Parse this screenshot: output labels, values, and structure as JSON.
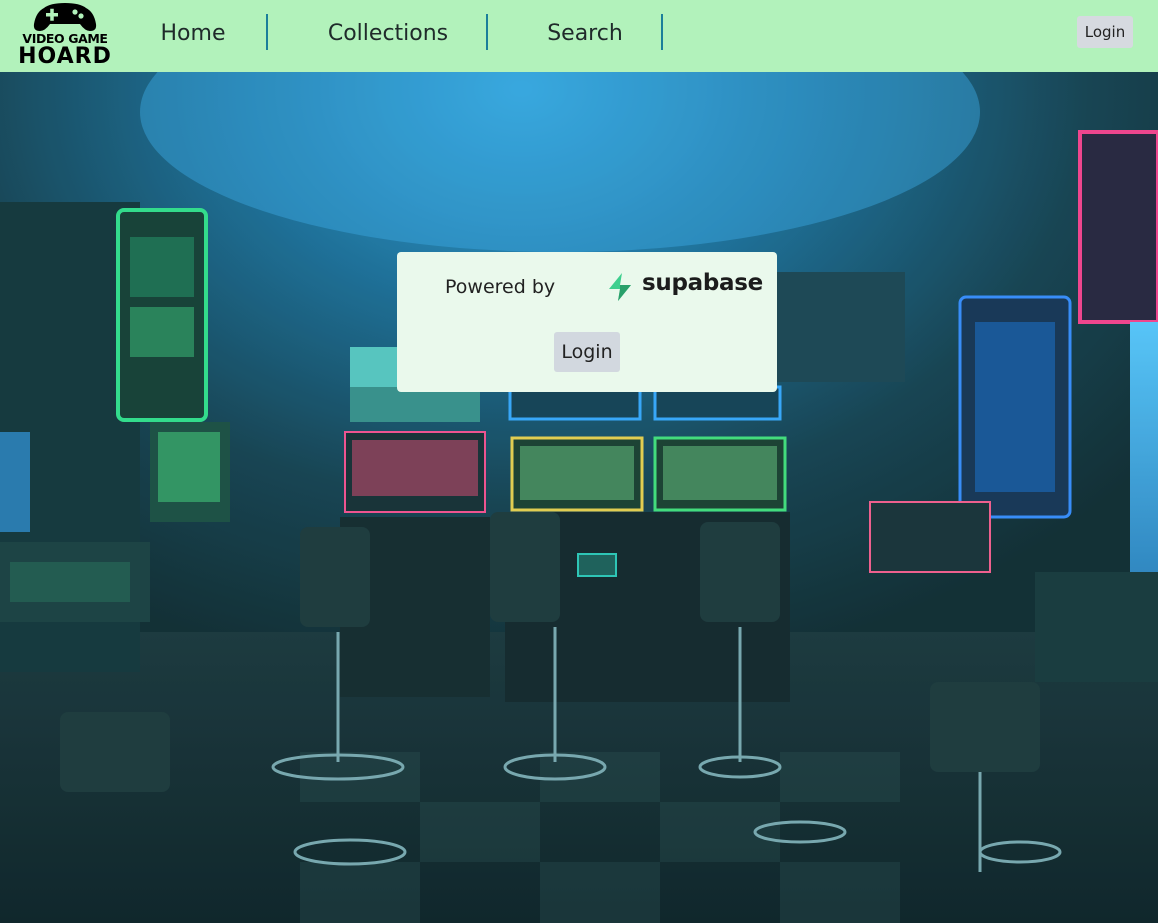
{
  "header": {
    "logo": {
      "line1": "VIDEO GAME",
      "line2": "HOARD"
    },
    "nav": [
      {
        "label": "Home"
      },
      {
        "label": "Collections"
      },
      {
        "label": "Search"
      }
    ],
    "login_label": "Login"
  },
  "card": {
    "powered_by": "Powered by",
    "brand": "supabase",
    "brand_icon": "supabase-bolt-icon",
    "login_label": "Login"
  },
  "colors": {
    "header_bg": "#b2f2bb",
    "nav_separator": "#1b7f9a",
    "card_bg": "#eaf9ec",
    "button_bg": "#d2d8df",
    "supabase_green": "#3ecf8e"
  }
}
